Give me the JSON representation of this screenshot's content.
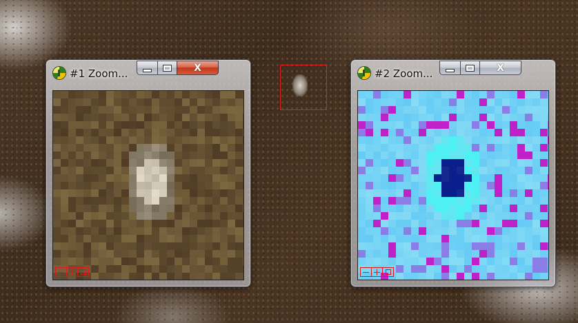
{
  "desktop": {
    "selection": {
      "stroke_color": "#e02020"
    }
  },
  "windows": [
    {
      "title": "#1 Zoom...",
      "close_color": "#c4361c",
      "view": "natural color",
      "controls": [
        "zoom-out",
        "zoom-in",
        "fit"
      ]
    },
    {
      "title": "#2 Zoom...",
      "view": "false color",
      "controls": [
        "zoom-out",
        "zoom-in",
        "fit"
      ]
    }
  ],
  "caption_buttons": {
    "close_glyph": "X"
  },
  "colors": {
    "terrain": "#3e2c1d",
    "zoom_control_red": "#e01818",
    "false_color_background": "#67e3f2",
    "false_color_target": "#0a1e8c",
    "false_color_hotspots": "#c020c8"
  }
}
